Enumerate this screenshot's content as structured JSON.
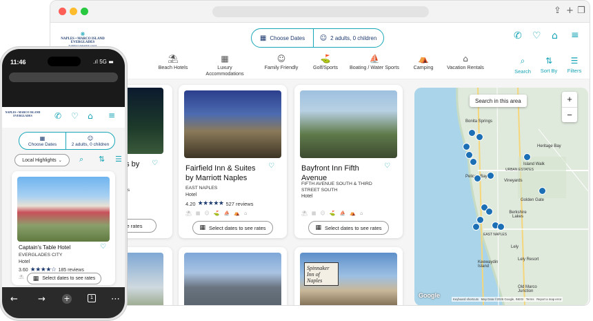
{
  "browser": {
    "window_controls": [
      "close",
      "minimize",
      "maximize"
    ],
    "toolbar_icons": [
      "share-icon",
      "new-tab-icon",
      "tabs-icon"
    ]
  },
  "site": {
    "logo": {
      "line1": "NAPLES • MARCO ISLAND",
      "line2": "EVERGLADES",
      "tagline": "FLORIDA'S PARADISE COAST"
    },
    "choose_dates": "Choose Dates",
    "guests": "2 adults, 0 children",
    "categories": [
      {
        "label": "Beach Hotels",
        "icon": "beach-umbrella-icon"
      },
      {
        "label": "Luxury\nAccommodations",
        "icon": "hotel-icon"
      },
      {
        "label": "Family Friendly",
        "icon": "family-icon"
      },
      {
        "label": "Golf/Sports",
        "icon": "golfer-icon"
      },
      {
        "label": "Boating / Water Sports",
        "icon": "boat-icon"
      },
      {
        "label": "Camping",
        "icon": "tent-icon"
      },
      {
        "label": "Vacation Rentals",
        "icon": "house-icon"
      }
    ],
    "tools": [
      {
        "label": "Search",
        "icon": "search-icon"
      },
      {
        "label": "Sort By",
        "icon": "sort-icon"
      },
      {
        "label": "Filters",
        "icon": "filters-icon"
      }
    ],
    "cards": [
      {
        "title_frag": "es by",
        "reviews_frag": "ews",
        "select_frag": "e rates"
      },
      {
        "title": "Fairfield Inn & Suites by Marriott Naples",
        "address": "EAST NAPLES",
        "type": "Hotel",
        "rating": "4.20",
        "reviews": "527 reviews",
        "select": "Select dates to see rates"
      },
      {
        "title": "Bayfront Inn Fifth Avenue",
        "address": "FIFTH AVENUE SOUTH & THIRD STREET SOUTH",
        "type": "Hotel",
        "select": "Select dates to see rates"
      }
    ],
    "sign_text": "Spinnaker\nInn of Naples",
    "map": {
      "search_button": "Search in this area",
      "zoom_in": "+",
      "zoom_out": "−",
      "labels": [
        "Bonita Springs",
        "Heritage Bay",
        "Island Walk",
        "URBAN ESTATES",
        "Vineyards",
        "Pelican Bay",
        "Golden Gate",
        "Berkshire Lakes",
        "EAST NAPLES",
        "Lely",
        "Lely Resort",
        "Keewaydin Island",
        "Old Marco Junction"
      ],
      "attribution": "Keyboard shortcuts   Map Data ©2026 Google, INEGI   Terms   Report a map error",
      "brand": "Google"
    }
  },
  "phone": {
    "time": "11:46",
    "signal": "5G",
    "choose_dates": "Choose Dates",
    "guests": "2 adults, 0 children",
    "filter": "Local Highlights",
    "card": {
      "title": "Captain's Table Hotel",
      "address": "EVERGLADES CITY",
      "type": "Hotel",
      "rating": "3.60",
      "reviews": "185 reviews",
      "select": "Select dates to see rates"
    },
    "nav": [
      "back-icon",
      "forward-icon",
      "new-tab-icon",
      "tabs-icon",
      "more-icon"
    ],
    "tab_count": "1"
  },
  "colors": {
    "accent": "#13a3b5",
    "navy": "#1c3a6e"
  }
}
